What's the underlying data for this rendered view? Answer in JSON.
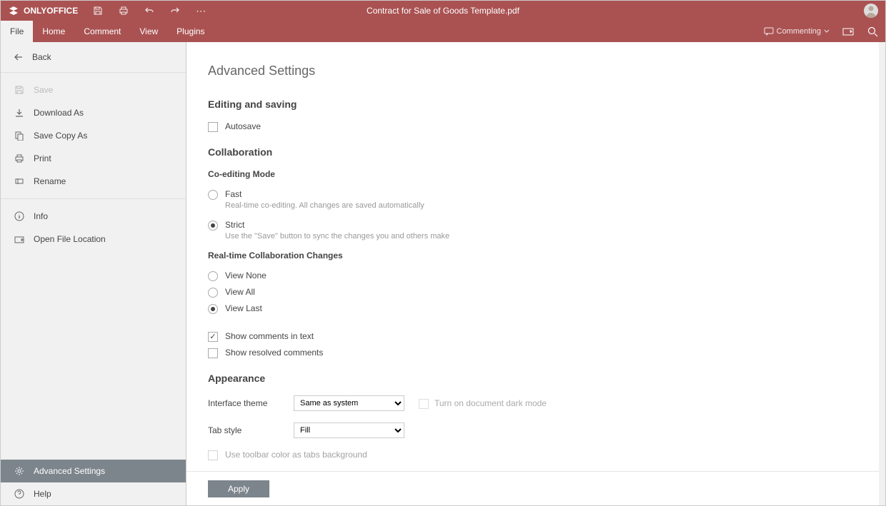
{
  "titlebar": {
    "app_name": "ONLYOFFICE",
    "doc_title": "Contract for Sale of Goods Template.pdf"
  },
  "tabs": {
    "file": "File",
    "home": "Home",
    "comment": "Comment",
    "view": "View",
    "plugins": "Plugins"
  },
  "right_tools": {
    "commenting": "Commenting"
  },
  "sidebar": {
    "back": "Back",
    "save": "Save",
    "download_as": "Download As",
    "save_copy_as": "Save Copy As",
    "print": "Print",
    "rename": "Rename",
    "info": "Info",
    "open_file_location": "Open File Location",
    "advanced_settings": "Advanced Settings",
    "help": "Help"
  },
  "settings": {
    "title": "Advanced Settings",
    "editing_saving": "Editing and saving",
    "autosave": "Autosave",
    "collaboration": "Collaboration",
    "coediting_mode": "Co-editing Mode",
    "fast": "Fast",
    "fast_desc": "Real-time co-editing. All changes are saved automatically",
    "strict": "Strict",
    "strict_desc": "Use the \"Save\" button to sync the changes you and others make",
    "rt_changes": "Real-time Collaboration Changes",
    "view_none": "View None",
    "view_all": "View All",
    "view_last": "View Last",
    "show_comments": "Show comments in text",
    "show_resolved": "Show resolved comments",
    "appearance": "Appearance",
    "interface_theme": "Interface theme",
    "theme_value": "Same as system",
    "tab_style": "Tab style",
    "tab_style_value": "Fill",
    "dark_mode": "Turn on document dark mode",
    "toolbar_color": "Use toolbar color as tabs background",
    "apply": "Apply"
  }
}
